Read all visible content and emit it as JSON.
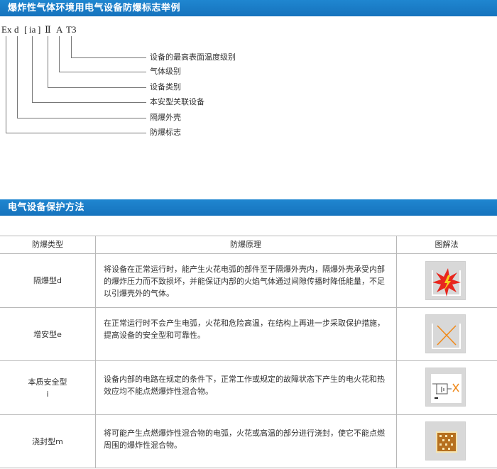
{
  "section1": {
    "title": "爆炸性气体环境用电气设备防爆标志举例",
    "code_parts": [
      "Ex",
      "d",
      "[",
      "ia",
      "]",
      "Ⅱ",
      "A",
      "T3"
    ],
    "labels": [
      "设备的最高表面温度级别",
      "气体级别",
      "设备类别",
      "本安型关联设备",
      "隔爆外壳",
      "防爆标志"
    ]
  },
  "section2": {
    "title": "电气设备保护方法",
    "table": {
      "headers": [
        "防爆类型",
        "防爆原理",
        "图解法"
      ],
      "rows": [
        {
          "type_line1": "隔爆型d",
          "type_line2": "",
          "description": "将设备在正常运行时，能产生火花电弧的部件至于隔爆外壳内，隔爆外壳承受内部的爆炸压力而不致损坏，并能保证内部的火焰气体通过间隙传播时降低能量，不足以引爆壳外的气体。",
          "icon": "flame-burst-icon"
        },
        {
          "type_line1": "增安型e",
          "type_line2": "",
          "description": "在正常运行时不会产生电弧，火花和危险高温，在结构上再进一步采取保护措施，提高设备的安全型和可靠性。",
          "icon": "x-cross-icon"
        },
        {
          "type_line1": "本质安全型",
          "type_line2": "i",
          "description": "设备内部的电路在规定的条件下，正常工作或规定的故障状态下产生的电火花和热效应均不能点燃爆炸性混合物。",
          "icon": "circuit-icon"
        },
        {
          "type_line1": "浇封型m",
          "type_line2": "",
          "description": "将可能产生点燃爆炸性混合物的电弧，火花或高温的部分进行浇封，使它不能点燃周围的爆炸性混合物。",
          "icon": "encapsulation-icon"
        }
      ]
    }
  },
  "colors": {
    "header_blue": "#1a7cc6",
    "flame_red": "#e8261e",
    "flame_yellow": "#f5d21a",
    "cross_orange": "#f08a1c",
    "encapsulation_brown": "#b6701f"
  }
}
